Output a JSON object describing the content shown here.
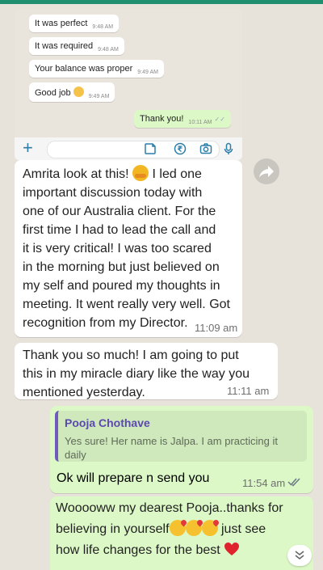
{
  "screenshot": {
    "messages": [
      {
        "text": "It was perfect",
        "time": "9:48 AM"
      },
      {
        "text": "It was required",
        "time": "9:48 AM"
      },
      {
        "text": "Your balance was proper",
        "time": "9:49 AM"
      },
      {
        "text": "Good job",
        "time": "9:49 AM"
      }
    ],
    "outgoing": {
      "text": "Thank you!",
      "time": "10:11 AM"
    },
    "compose_icons": [
      "plus-icon",
      "sticker-icon",
      "rupee-icon",
      "camera-icon",
      "mic-icon"
    ]
  },
  "chat": {
    "msg1": {
      "lines": [
        "Amrita look at this!",
        "important discussion today with",
        "one of our Australia client. For the",
        "first time I had to lead the call and",
        "it is very critical! I was too scared",
        "in the morning but just believed on",
        "my self and poured my thoughts in",
        "meeting. It went really very well. Got",
        "recognition from my Director."
      ],
      "line1_tail": "I led one",
      "time": "11:09 am"
    },
    "msg2": {
      "lines": [
        "Thank you so much! I am going to put",
        "this in my miracle diary like the way you",
        "mentioned yesterday."
      ],
      "time": "11:11 am"
    },
    "reply": {
      "quote_name": "Pooja Chothave",
      "quote_text": "Yes sure! Her name is Jalpa. I am practicing it daily",
      "text": "Ok will prepare n send you",
      "time": "11:54 am"
    },
    "msg4": {
      "line1": "Wooooww  my dearest Pooja..thanks for",
      "line2_head": "believing in yourself",
      "line2_tail": "just see",
      "line3": "how life changes for the best"
    }
  },
  "colors": {
    "outgoing_bubble": "#dcf8c6",
    "incoming_bubble": "#ffffff",
    "read_ticks": "#53a6e6",
    "quote_accent": "#6f5bbd",
    "top_bar": "#1f8f6f"
  }
}
